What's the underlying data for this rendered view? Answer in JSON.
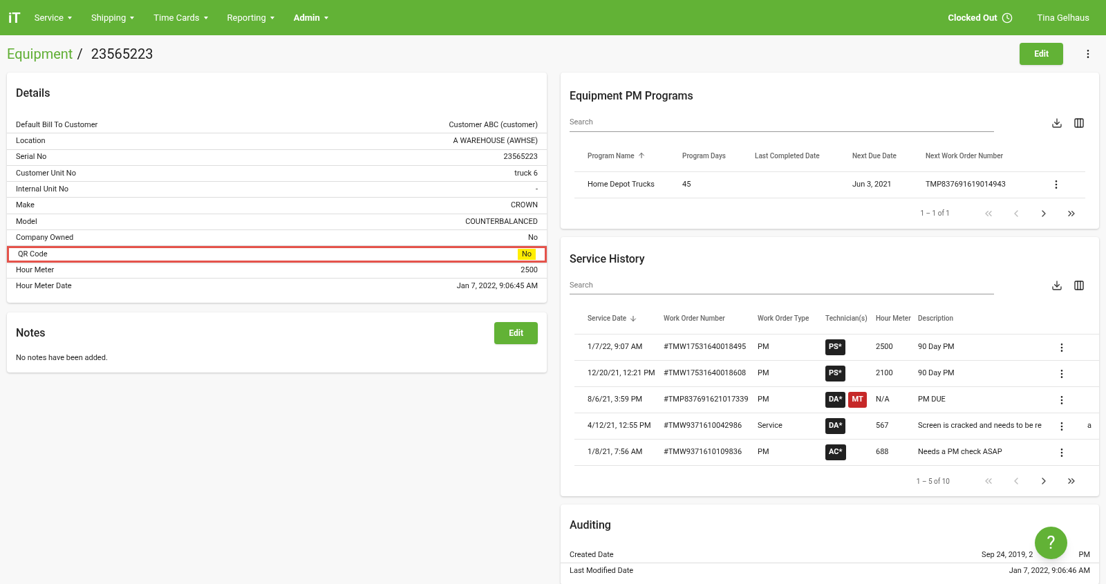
{
  "nav": {
    "logo": "iT",
    "menus": [
      {
        "label": "Service",
        "selected": false
      },
      {
        "label": "Shipping",
        "selected": false
      },
      {
        "label": "Time Cards",
        "selected": false
      },
      {
        "label": "Reporting",
        "selected": false
      },
      {
        "label": "Admin",
        "selected": true
      }
    ],
    "clock_status": "Clocked Out",
    "user": "Tina Gelhaus"
  },
  "breadcrumb": {
    "parent": "Equipment",
    "separator": "/",
    "current": "23565223"
  },
  "page_actions": {
    "edit": "Edit"
  },
  "details": {
    "title": "Details",
    "rows": [
      {
        "label": "Default Bill To Customer",
        "value": "Customer ABC (customer)",
        "highlighted": false
      },
      {
        "label": "Location",
        "value": "A WAREHOUSE (AWHSE)",
        "highlighted": false
      },
      {
        "label": "Serial No",
        "value": "23565223",
        "highlighted": false
      },
      {
        "label": "Customer Unit No",
        "value": "truck 6",
        "highlighted": false
      },
      {
        "label": "Internal Unit No",
        "value": "-",
        "highlighted": false
      },
      {
        "label": "Make",
        "value": "CROWN",
        "highlighted": false
      },
      {
        "label": "Model",
        "value": "COUNTERBALANCED",
        "highlighted": false
      },
      {
        "label": "Company Owned",
        "value": "No",
        "highlighted": false
      },
      {
        "label": "QR Code",
        "value": "No",
        "highlighted": true
      },
      {
        "label": "Hour Meter",
        "value": "2500",
        "highlighted": false
      },
      {
        "label": "Hour Meter Date",
        "value": "Jan 7, 2022, 9:06:45 AM",
        "highlighted": false
      }
    ]
  },
  "notes": {
    "title": "Notes",
    "edit": "Edit",
    "empty": "No notes have been added."
  },
  "pm_programs": {
    "title": "Equipment PM Programs",
    "search_placeholder": "Search",
    "columns": [
      {
        "label": "Program Name",
        "sorted": true,
        "ascending": true
      },
      {
        "label": "Program Days",
        "sorted": false
      },
      {
        "label": "Last Completed Date",
        "sorted": false
      },
      {
        "label": "Next Due Date",
        "sorted": false
      },
      {
        "label": "Next Work Order Number",
        "sorted": false
      }
    ],
    "rows": [
      {
        "cells": [
          "Home Depot Trucks",
          "45",
          "",
          "Jun 3, 2021",
          "TMP837691619014943"
        ]
      }
    ],
    "pagination": "1 – 1 of 1"
  },
  "service_history": {
    "title": "Service History",
    "search_placeholder": "Search",
    "columns": [
      {
        "label": "Service Date",
        "sorted": true,
        "ascending": false
      },
      {
        "label": "Work Order Number",
        "sorted": false
      },
      {
        "label": "Work Order Type",
        "sorted": false
      },
      {
        "label": "Technician(s)",
        "sorted": false
      },
      {
        "label": "Hour Meter",
        "sorted": false
      },
      {
        "label": "Description",
        "sorted": false
      }
    ],
    "rows": [
      {
        "date": "1/7/22, 9:07 AM",
        "work_order": "#TMW17531640018495",
        "type": "PM",
        "technicians": [
          {
            "label": "PS*",
            "color": "#212121"
          }
        ],
        "hour_meter": "2500",
        "description": "90 Day PM"
      },
      {
        "date": "12/20/21, 12:21 PM",
        "work_order": "#TMW17531640018608",
        "type": "PM",
        "technicians": [
          {
            "label": "PS*",
            "color": "#212121"
          }
        ],
        "hour_meter": "2100",
        "description": "90 Day PM"
      },
      {
        "date": "8/6/21, 3:59 PM",
        "work_order": "#TMP837691621017339",
        "type": "PM",
        "technicians": [
          {
            "label": "DA*",
            "color": "#212121"
          },
          {
            "label": "MT",
            "color": "#c62828"
          }
        ],
        "hour_meter": "N/A",
        "description": "PM DUE"
      },
      {
        "date": "4/12/21, 12:55 PM",
        "work_order": "#TMW9371610042986",
        "type": "Service",
        "technicians": [
          {
            "label": "DA*",
            "color": "#212121"
          }
        ],
        "hour_meter": "567",
        "description": "Screen is cracked and needs to be re",
        "overflow": "a"
      },
      {
        "date": "1/8/21, 7:56 AM",
        "work_order": "#TMW9371610109836",
        "type": "PM",
        "technicians": [
          {
            "label": "AC*",
            "color": "#212121"
          }
        ],
        "hour_meter": "688",
        "description": "Needs a PM check ASAP"
      }
    ],
    "pagination": "1 – 5 of 10"
  },
  "auditing": {
    "title": "Auditing",
    "rows": [
      {
        "label": "Created Date",
        "value": "Sep 24, 2019, 2",
        "value_end": "PM"
      },
      {
        "label": "Last Modified Date",
        "value": "Jan 7, 2022, 9:06:46 AM"
      }
    ]
  },
  "help_button": "?"
}
